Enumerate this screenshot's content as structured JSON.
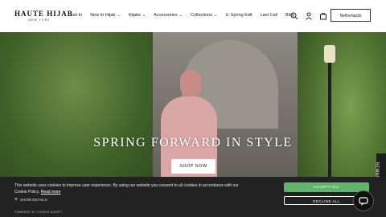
{
  "brand": {
    "name": "HAUTE HIJAB",
    "tagline": "NEW YORK"
  },
  "nav": {
    "items": [
      {
        "label": "Just In",
        "dropdown": false
      },
      {
        "label": "New to Hijab",
        "dropdown": true
      },
      {
        "label": "Hijabs",
        "dropdown": true
      },
      {
        "label": "Accessories",
        "dropdown": true
      },
      {
        "label": "Collections",
        "dropdown": true
      },
      {
        "label": "Spring Edit",
        "dropdown": false,
        "marker": "flower-icon"
      },
      {
        "label": "Last Call",
        "dropdown": false
      },
      {
        "label": "Blog",
        "dropdown": false
      }
    ],
    "icons": [
      "search-icon",
      "account-icon",
      "cart-icon"
    ],
    "region": "Netherlands"
  },
  "hero": {
    "headline": "SPRING FORWARD IN STYLE",
    "cta": "SHOP NOW"
  },
  "rewards": {
    "label": "REWARDS"
  },
  "cookie_banner": {
    "text": "This website uses cookies to improve user experience. By using our website you consent to all cookies in accordance with our Cookie Policy.",
    "link": "Read more",
    "details": "SHOW DETAILS",
    "powered": "POWERED BY COOKIE-SCRIPT",
    "accept": "ACCEPT ALL",
    "decline": "DECLINE ALL"
  },
  "colors": {
    "accent_green": "#62b46d",
    "banner_bg": "#222222"
  }
}
